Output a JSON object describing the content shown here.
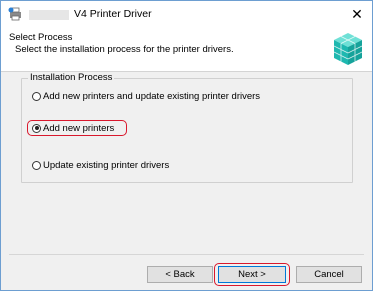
{
  "window": {
    "title": "V4 Printer Driver",
    "close_glyph": "✕"
  },
  "header": {
    "title": "Select Process",
    "subtitle": "Select the installation process for the printer drivers."
  },
  "group": {
    "label": "Installation Process",
    "options": [
      {
        "label": "Add new printers and update existing printer drivers",
        "checked": false
      },
      {
        "label": "Add new printers",
        "checked": true
      },
      {
        "label": "Update existing printer drivers",
        "checked": false
      }
    ]
  },
  "buttons": {
    "back": "< Back",
    "next": "Next >",
    "cancel": "Cancel"
  },
  "colors": {
    "highlight": "#d9182d",
    "accent": "#0078d7"
  },
  "icons": {
    "app": "printer-setup-icon",
    "header": "cube-stack-graphic",
    "close": "close-icon"
  }
}
